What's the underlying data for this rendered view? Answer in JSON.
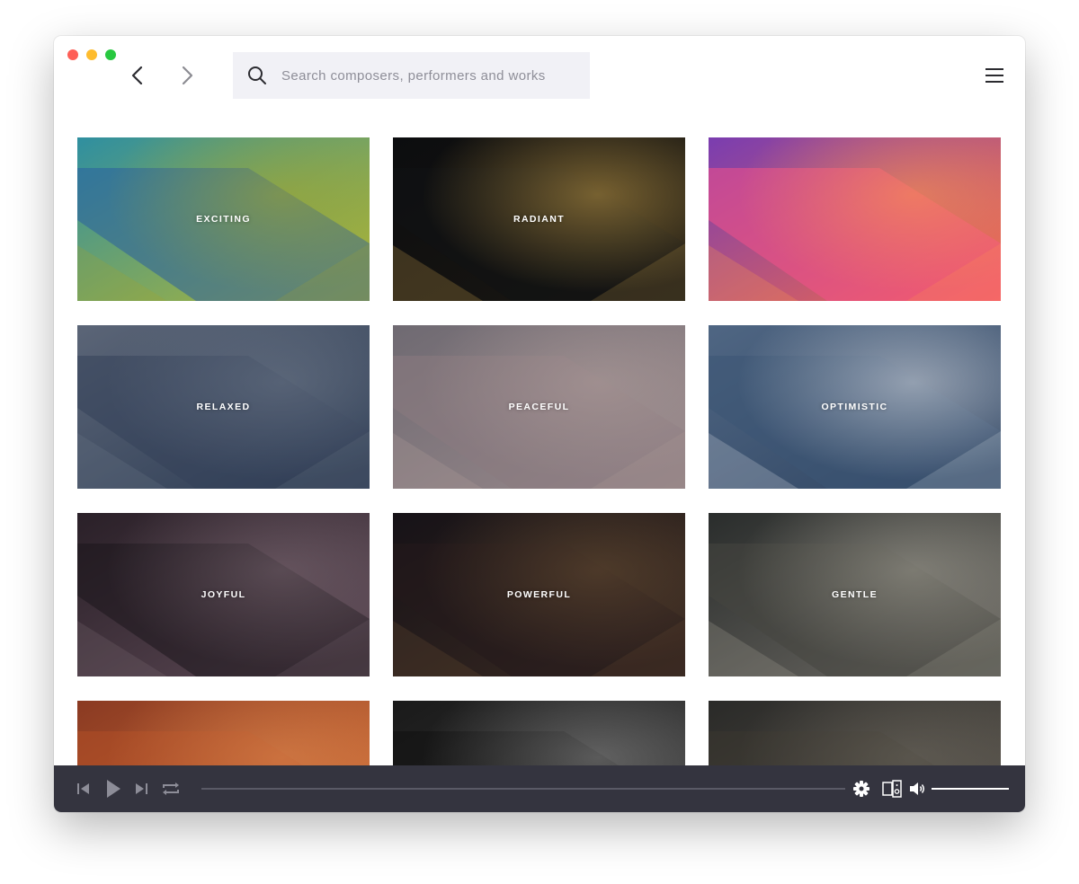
{
  "search": {
    "placeholder": "Search composers, performers and works",
    "value": ""
  },
  "moods": [
    {
      "label": "EXCITING",
      "bg": [
        "#2f8fa0",
        "#b4b832"
      ],
      "shape": "#2a5fa0",
      "tint": "#a3a52a"
    },
    {
      "label": "RADIANT",
      "bg": [
        "#0c0d0f",
        "#1a1712"
      ],
      "shape": "#111214",
      "tint": "#c9a14a"
    },
    {
      "label": "",
      "bg": [
        "#7a3db0",
        "#f36a4a"
      ],
      "shape": "#f4508a",
      "tint": "#ff9a4a"
    },
    {
      "label": "RELAXED",
      "bg": [
        "#5b6577",
        "#2b3a52"
      ],
      "shape": "#34425a",
      "tint": "#6d7889"
    },
    {
      "label": "PEACEFUL",
      "bg": [
        "#6f6a72",
        "#9a8a8c"
      ],
      "shape": "#8a7a80",
      "tint": "#b29f9c"
    },
    {
      "label": "OPTIMISTIC",
      "bg": [
        "#4f6683",
        "#2f4461"
      ],
      "shape": "#3c5675",
      "tint": "#d9dce2"
    },
    {
      "label": "JOYFUL",
      "bg": [
        "#2a2028",
        "#5e4a56"
      ],
      "shape": "#1c161c",
      "tint": "#7d6a74"
    },
    {
      "label": "POWERFUL",
      "bg": [
        "#161217",
        "#3a2a22"
      ],
      "shape": "#241a1c",
      "tint": "#6c5134"
    },
    {
      "label": "GENTLE",
      "bg": [
        "#2a2d2c",
        "#6f6c66"
      ],
      "shape": "#45453f",
      "tint": "#a6a397"
    },
    {
      "label": "",
      "bg": [
        "#8a3a22",
        "#d8753a"
      ],
      "shape": "#b04e26",
      "tint": "#e08a50"
    },
    {
      "label": "",
      "bg": [
        "#1a1a1a",
        "#3a3a3a"
      ],
      "shape": "#101010",
      "tint": "#8d8d8d"
    },
    {
      "label": "",
      "bg": [
        "#2a2a28",
        "#5d574f"
      ],
      "shape": "#3a3630",
      "tint": "#6f6a60"
    }
  ],
  "player": {
    "progress": 0,
    "volume": 1.0
  },
  "colors": {
    "player_bg": "#34343f",
    "search_bg": "#f1f1f6"
  }
}
